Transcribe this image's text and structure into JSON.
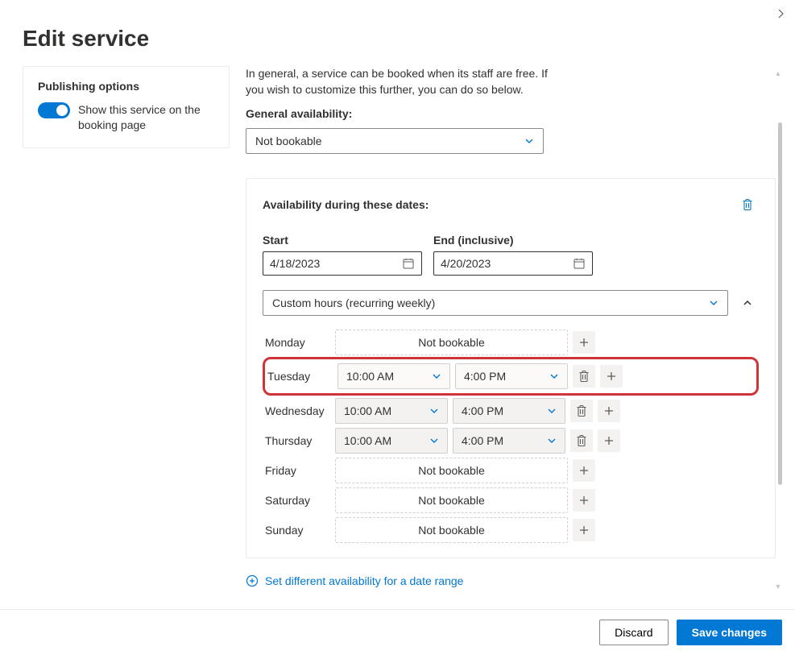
{
  "header": {
    "title": "Edit service"
  },
  "sidebar": {
    "publishing": {
      "title": "Publishing options",
      "toggle_label": "Show this service on the booking page",
      "toggle_on": true
    }
  },
  "main": {
    "intro_line1": "In general, a service can be booked when its staff are free. If",
    "intro_line2": "you wish to customize this further, you can do so below.",
    "general_label": "General availability:",
    "general_value": "Not bookable",
    "availability": {
      "heading": "Availability during these dates:",
      "start_label": "Start",
      "end_label": "End (inclusive)",
      "start_value": "4/18/2023",
      "end_value": "4/20/2023",
      "recurring_label": "Custom hours (recurring weekly)",
      "not_bookable": "Not bookable",
      "days": [
        {
          "name": "Monday",
          "bookable": false
        },
        {
          "name": "Tuesday",
          "bookable": true,
          "start": "10:00 AM",
          "end": "4:00 PM",
          "highlight": true
        },
        {
          "name": "Wednesday",
          "bookable": true,
          "start": "10:00 AM",
          "end": "4:00 PM"
        },
        {
          "name": "Thursday",
          "bookable": true,
          "start": "10:00 AM",
          "end": "4:00 PM"
        },
        {
          "name": "Friday",
          "bookable": false
        },
        {
          "name": "Saturday",
          "bookable": false
        },
        {
          "name": "Sunday",
          "bookable": false
        }
      ]
    },
    "link_text": "Set different availability for a date range"
  },
  "footer": {
    "discard": "Discard",
    "save": "Save changes"
  }
}
